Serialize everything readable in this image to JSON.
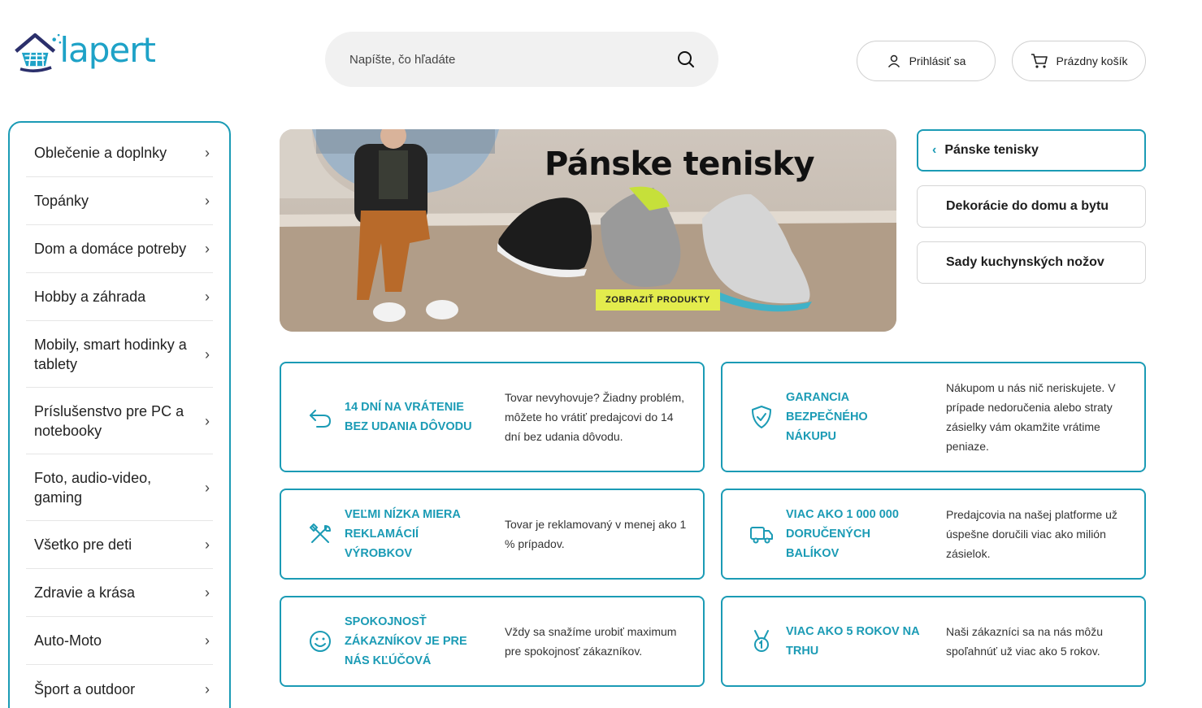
{
  "brand": {
    "name": "lapert",
    "accent": "#1b9bb5",
    "logo_blue": "#1ea2c7"
  },
  "search": {
    "placeholder": "Napíšte, čo hľadáte",
    "icon": "search-icon"
  },
  "header": {
    "login_label": "Prihlásiť sa",
    "cart_label": "Prázdny košík"
  },
  "sidebar": {
    "items": [
      {
        "label": "Oblečenie a doplnky"
      },
      {
        "label": "Topánky"
      },
      {
        "label": "Dom a domáce potreby"
      },
      {
        "label": "Hobby a záhrada"
      },
      {
        "label": "Mobily, smart hodinky a tablety"
      },
      {
        "label": "Príslušenstvo pre PC a notebooky"
      },
      {
        "label": "Foto, audio-video, gaming"
      },
      {
        "label": "Všetko pre deti"
      },
      {
        "label": "Zdravie a krása"
      },
      {
        "label": "Auto-Moto"
      },
      {
        "label": "Šport a outdoor"
      }
    ],
    "chevron": "›"
  },
  "banner": {
    "title": "Pánske tenisky",
    "button_label": "ZOBRAZIŤ PRODUKTY",
    "button_color": "#e3ec4d"
  },
  "side_links": [
    {
      "label": "Pánske tenisky",
      "back": "‹"
    },
    {
      "label": "Dekorácie do domu a bytu"
    },
    {
      "label": "Sady kuchynských nožov"
    }
  ],
  "features": [
    {
      "title": "14 DNÍ NA VRÁTENIE BEZ UDANIA DÔVODU",
      "desc": "Tovar nevyhovuje? Žiadny problém, môžete ho vrátiť predajcovi do 14 dní bez udania dôvodu.",
      "icon": "return-arrow-icon"
    },
    {
      "title": "GARANCIA BEZPEČNÉHO NÁKUPU",
      "desc": "Nákupom u nás nič neriskujete. V prípade nedoručenia alebo straty zásielky vám okamžite vrátime peniaze.",
      "icon": "shield-check-icon"
    },
    {
      "title": "VEĽMI NÍZKA MIERA REKLAMÁCIÍ VÝROBKOV",
      "desc": "Tovar je reklamovaný v menej ako 1 % prípadov.",
      "icon": "tools-icon"
    },
    {
      "title": "VIAC AKO 1 000 000 DORUČENÝCH BALÍKOV",
      "desc": "Predajcovia na našej platforme už úspešne doručili viac ako milión zásielok.",
      "icon": "truck-icon"
    },
    {
      "title": "SPOKOJNOSŤ ZÁKAZNÍKOV JE PRE NÁS KĽÚČOVÁ",
      "desc": "Vždy sa snažíme urobiť maximum pre spokojnosť zákazníkov.",
      "icon": "smile-icon"
    },
    {
      "title": "VIAC AKO 5 ROKOV NA TRHU",
      "desc": "Naši zákazníci sa na nás môžu spoľahnúť už viac ako 5 rokov.",
      "icon": "medal-icon"
    }
  ]
}
